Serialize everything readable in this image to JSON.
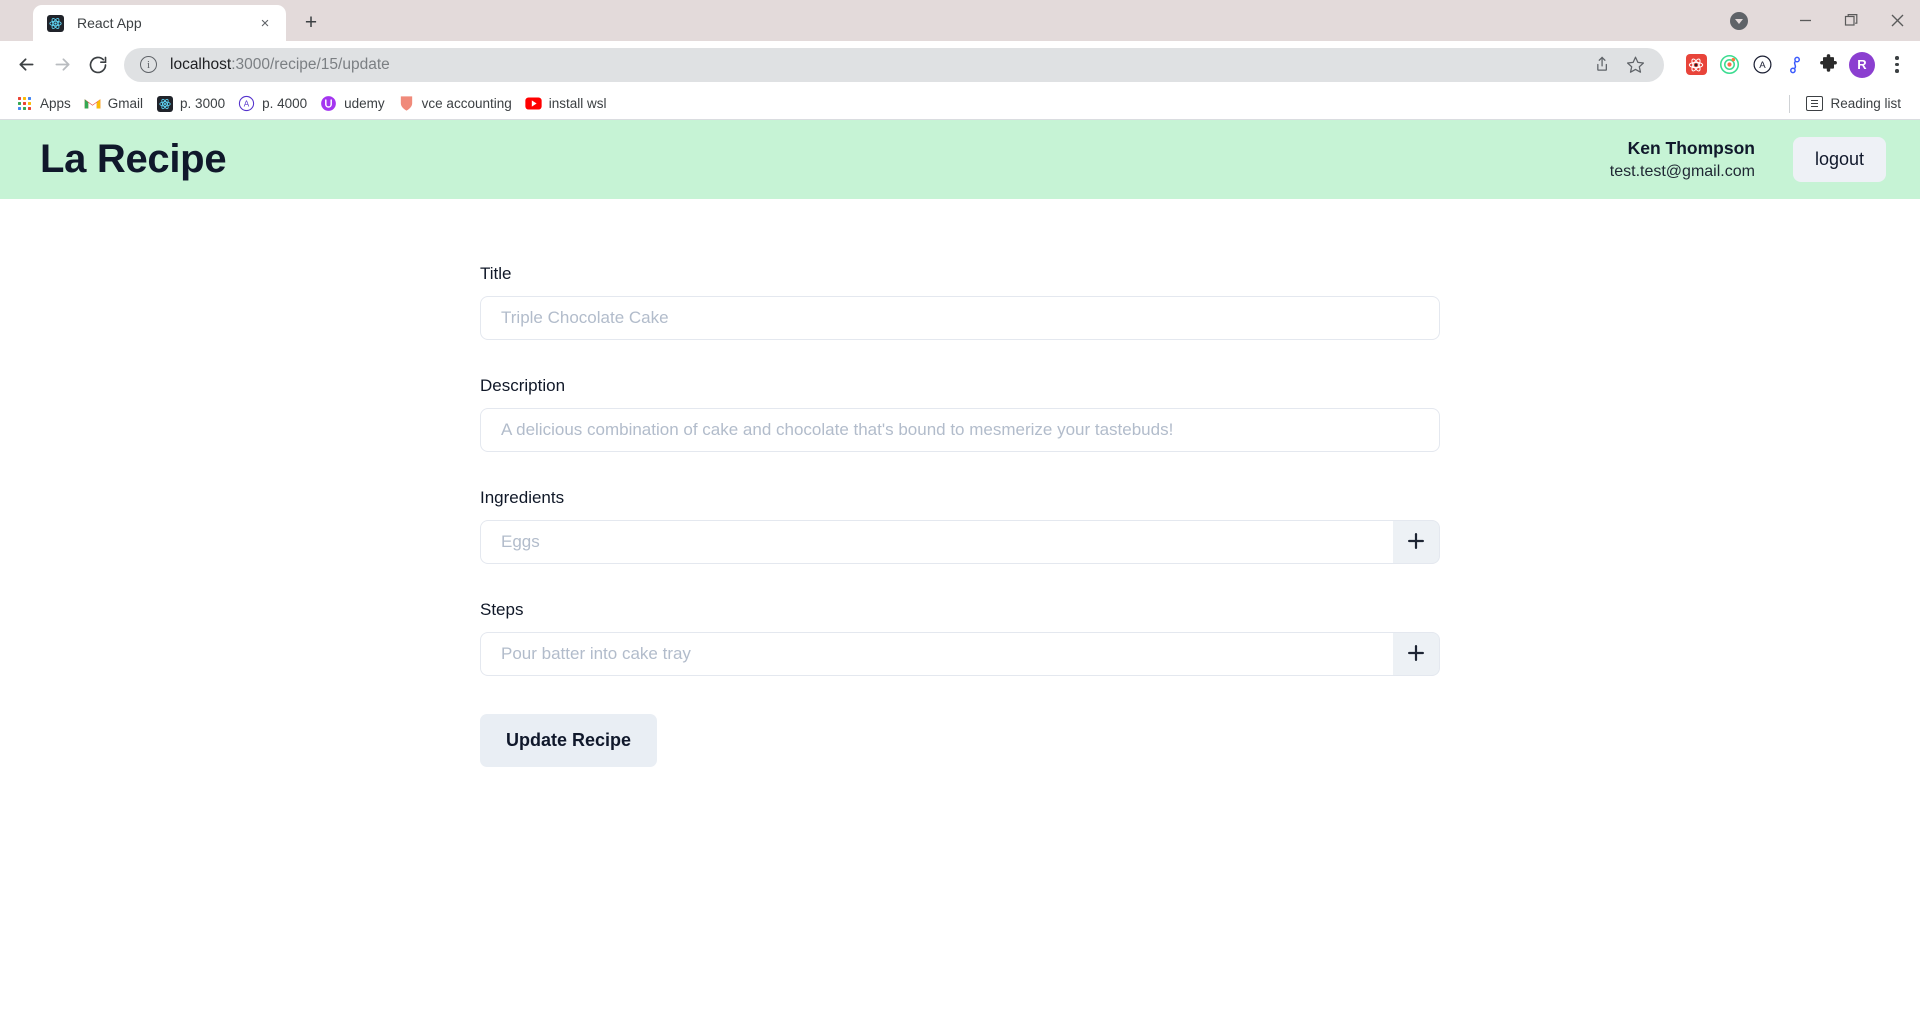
{
  "browser": {
    "tab": {
      "title": "React App",
      "favicon": "react-logo-icon",
      "close_label": "×"
    },
    "new_tab_label": "+",
    "window_controls": {
      "tab_search": "tab-search-icon",
      "minimize": "minimize-icon",
      "maximize": "maximize-icon",
      "close": "close-icon"
    },
    "nav": {
      "back": "back-arrow-icon",
      "forward": "forward-arrow-icon",
      "reload": "reload-icon"
    },
    "omnibox": {
      "info_glyph": "i",
      "host": "localhost",
      "path": ":3000/recipe/15/update",
      "url_full": "localhost:3000/recipe/15/update",
      "share_icon": "share-icon",
      "bookmark_icon": "star-icon"
    },
    "extensions": [
      {
        "name": "react-devtools-extension",
        "label": "React DevTools"
      },
      {
        "name": "circle-target-extension",
        "label": "Extension"
      },
      {
        "name": "letter-a-extension",
        "label": "A"
      },
      {
        "name": "blue-node-extension",
        "label": "Extension"
      },
      {
        "name": "puzzle-extensions-button",
        "label": "Extensions"
      }
    ],
    "profile_initial": "R",
    "menu": "kebab-menu-icon",
    "bookmarks": [
      {
        "label": "Apps",
        "icon": "apps-grid-icon"
      },
      {
        "label": "Gmail",
        "icon": "gmail-icon"
      },
      {
        "label": "p. 3000",
        "icon": "react-logo-icon"
      },
      {
        "label": "p. 4000",
        "icon": "letter-a-circle-icon"
      },
      {
        "label": "udemy",
        "icon": "udemy-icon"
      },
      {
        "label": "vce accounting",
        "icon": "shield-icon"
      },
      {
        "label": "install wsl",
        "icon": "youtube-icon"
      }
    ],
    "reading_list": {
      "label": "Reading list",
      "icon": "reading-list-icon"
    }
  },
  "app": {
    "brand": "La Recipe",
    "header_bg": "#c6f3d5",
    "user": {
      "name": "Ken Thompson",
      "email": "test.test@gmail.com"
    },
    "logout_label": "logout",
    "form": {
      "fields": [
        {
          "label": "Title",
          "placeholder": "Triple Chocolate Cake",
          "value": "",
          "has_add": false,
          "name": "title"
        },
        {
          "label": "Description",
          "placeholder": "A delicious combination of cake and chocolate that's bound to mesmerize your tastebuds!",
          "value": "",
          "has_add": false,
          "name": "description"
        },
        {
          "label": "Ingredients",
          "placeholder": "Eggs",
          "value": "",
          "has_add": true,
          "name": "ingredients"
        },
        {
          "label": "Steps",
          "placeholder": "Pour batter into cake tray",
          "value": "",
          "has_add": true,
          "name": "steps"
        }
      ],
      "add_icon": "plus-icon",
      "submit_label": "Update Recipe"
    }
  }
}
